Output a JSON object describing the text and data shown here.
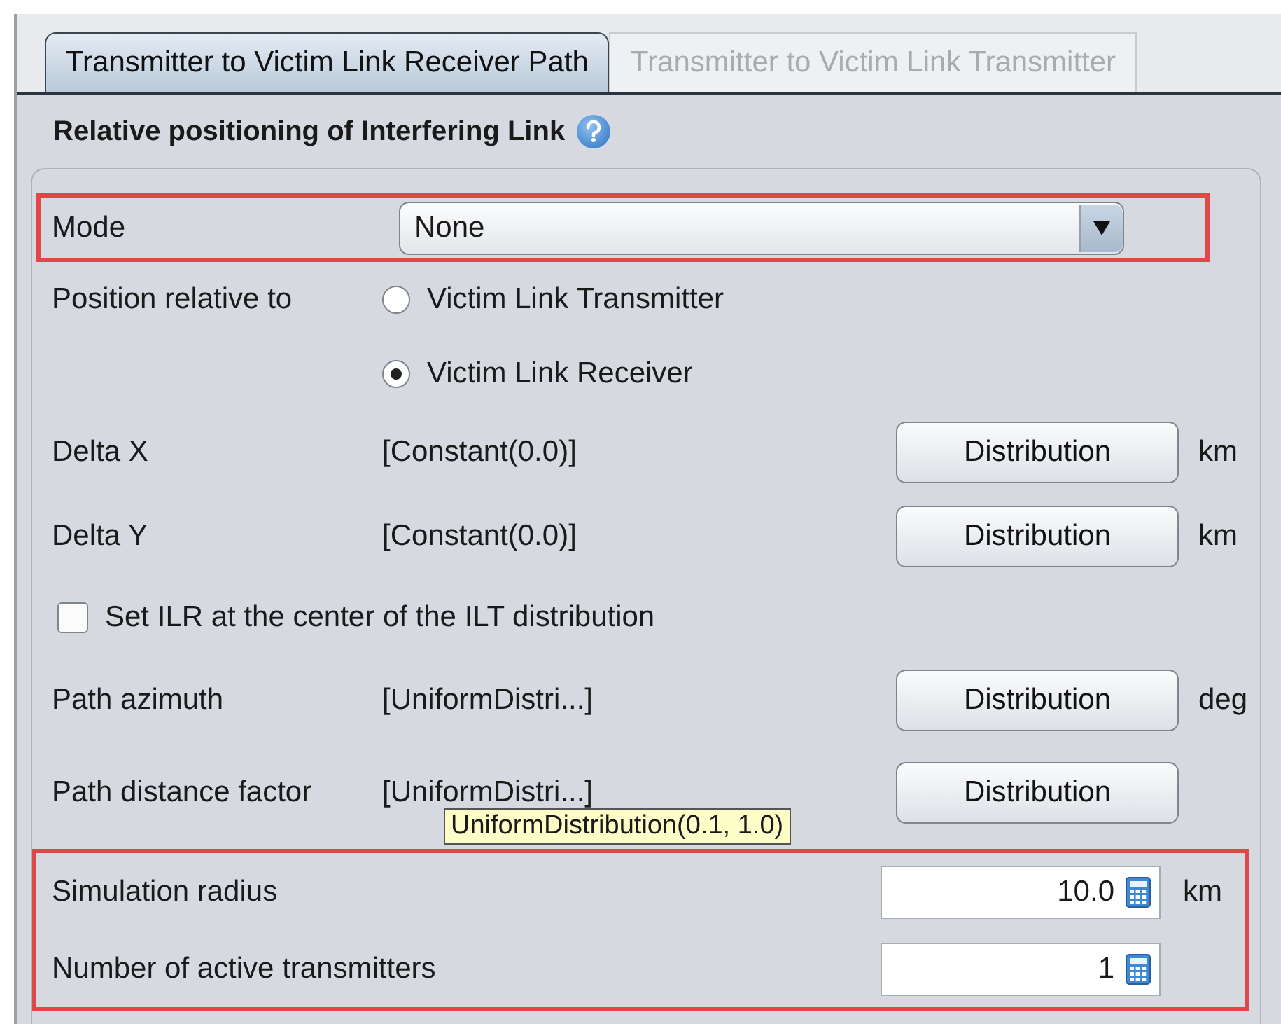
{
  "tabs": [
    {
      "label": "Transmitter to Victim Link Receiver Path",
      "selected": true
    },
    {
      "label": "Transmitter to Victim Link Transmitter",
      "selected": false
    }
  ],
  "section_title": "Relative positioning of Interfering Link",
  "mode": {
    "label": "Mode",
    "value": "None"
  },
  "position": {
    "label": "Position relative to",
    "options": [
      {
        "label": "Victim Link Transmitter",
        "selected": false
      },
      {
        "label": "Victim Link Receiver",
        "selected": true
      }
    ]
  },
  "parameters": [
    {
      "kind": "distribution",
      "label": "Delta X",
      "value": "[Constant(0.0)]",
      "button": "Distribution",
      "unit": "km"
    },
    {
      "kind": "distribution",
      "label": "Delta Y",
      "value": "[Constant(0.0)]",
      "button": "Distribution",
      "unit": "km"
    },
    {
      "kind": "checkbox",
      "label": "Set ILR at the center of the ILT distribution",
      "checked": false
    },
    {
      "kind": "distribution",
      "label": "Path azimuth",
      "value": "[UniformDistri...]",
      "button": "Distribution",
      "unit": "deg"
    },
    {
      "kind": "distribution",
      "label": "Path distance factor",
      "value": "[UniformDistri...]",
      "button": "Distribution",
      "tooltip": "UniformDistribution(0.1, 1.0)"
    }
  ],
  "fields": [
    {
      "label": "Simulation radius",
      "value": "10.0",
      "unit": "km"
    },
    {
      "label": "Number of active transmitters",
      "value": "1"
    }
  ]
}
